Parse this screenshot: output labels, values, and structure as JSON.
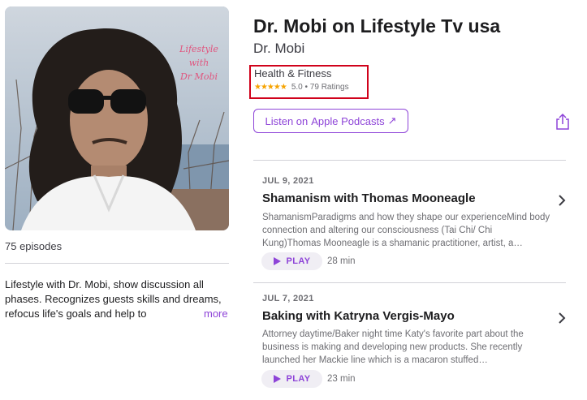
{
  "podcast": {
    "title": "Dr. Mobi on Lifestyle Tv usa",
    "author": "Dr. Mobi",
    "category": "Health & Fitness",
    "stars": "★★★★★",
    "rating_text": "5.0 • 79 Ratings",
    "cover_text": [
      "Lifestyle",
      "with",
      "Dr Mobi"
    ],
    "episodes_count": "75 episodes",
    "description": "Lifestyle with Dr. Mobi, show discussion all phases. Recognizes guests skills and dreams, refocus life's goals and help to",
    "more_label": "more"
  },
  "listen": {
    "prefix": "Listen on",
    "brand": "Apple Podcasts",
    "arrow": "↗"
  },
  "episodes": [
    {
      "date": "JUL 9, 2021",
      "title": "Shamanism with Thomas Mooneagle",
      "description": "ShamanismParadigms and how they shape our experienceMind body connection and altering our consciousness (Tai Chi/ Chi Kung)Thomas Mooneagle is a shamanic practitioner, artist, a…",
      "play_label": "PLAY",
      "duration": "28 min"
    },
    {
      "date": "JUL 7, 2021",
      "title": "Baking with Katryna Vergis-Mayo",
      "description": "Attorney daytime/Baker night time Katy's favorite part about the business is making and developing new products. She recently launched her Mackie line which is a macaron stuffed…",
      "play_label": "PLAY",
      "duration": "23 min"
    }
  ],
  "colors": {
    "accent": "#8e44d8",
    "stars": "#f6a300",
    "highlight": "#d0021b"
  },
  "icons": {
    "share": "share-icon",
    "chevron": "chevron-right-icon",
    "play": "play-icon"
  }
}
